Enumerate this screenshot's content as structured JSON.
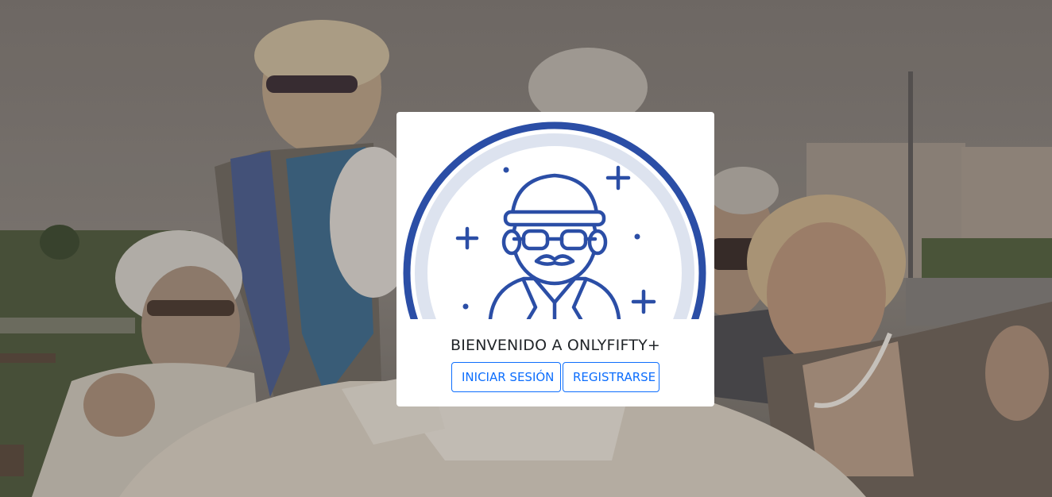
{
  "background": {
    "description_icon": "group-of-smiling-seniors-photo"
  },
  "card": {
    "logo_icon": "elderly-man-avatar-logo",
    "title": "BIENVENIDO A ONLYFIFTY+",
    "login_label": "INICIAR SESIÓN",
    "register_label": "REGISTRARSE"
  },
  "colors": {
    "accent": "#0d6efd",
    "logo_blue": "#2b4ea6",
    "logo_ring_light": "#dde3ef"
  }
}
